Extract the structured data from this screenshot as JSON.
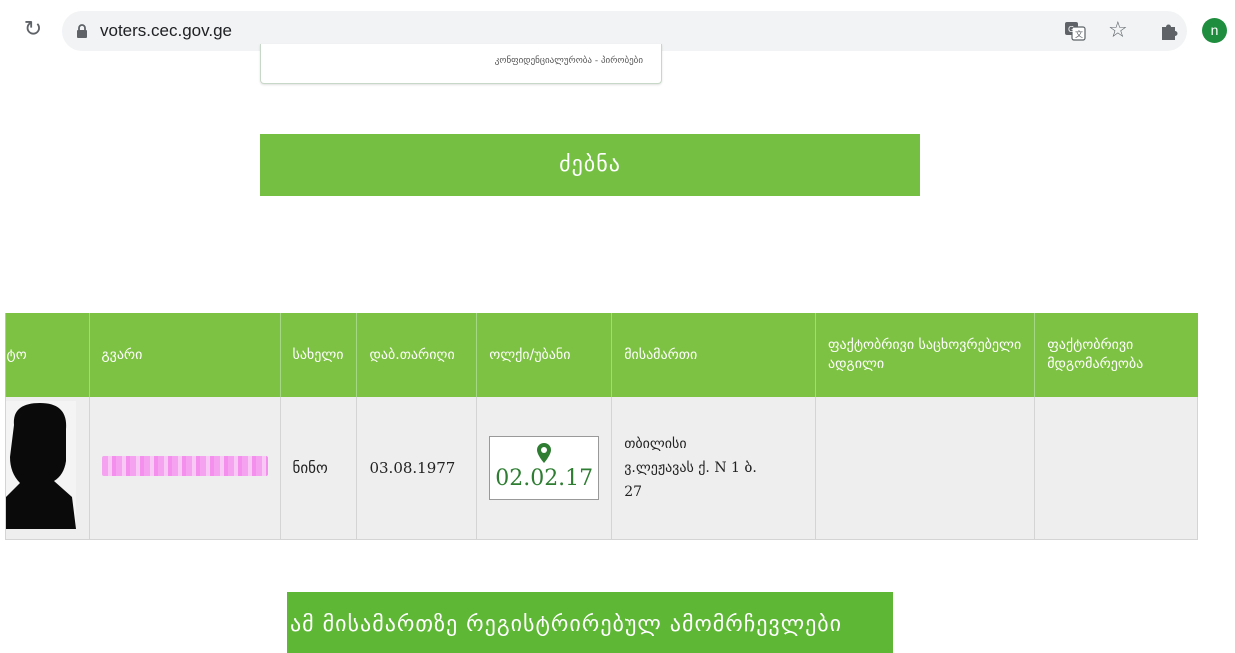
{
  "browser": {
    "url": "voters.cec.gov.ge",
    "avatar_initial": "n"
  },
  "captcha": {
    "links": "კონფიდენციალურობა - პირობები"
  },
  "search_button": "ძებნა",
  "table": {
    "headers": {
      "photo": "ფოტო",
      "surname": "გვარი",
      "name": "სახელი",
      "dob": "დაბ.თარიღი",
      "district": "ოლქი/უბანი",
      "address": "მისამართი",
      "actual_residence": "ფაქტობრივი საცხოვრებელი ადგილი",
      "actual_status": "ფაქტობრივი მდგომარეობა"
    },
    "row": {
      "name": "ნინო",
      "dob": "03.08.1977",
      "district_code": "02.02.17",
      "address_city": "თბილისი",
      "address_street": "ვ.ლეჟავას ქ.",
      "address_num1": "N 1 ბ.",
      "address_num2": "27",
      "actual_residence": "",
      "actual_status": ""
    }
  },
  "voters_button": "ამ მისამართზე რეგისტრირებულ ამომრჩევლები",
  "colors": {
    "header_green": "#7dc242",
    "button_green": "#75c043",
    "district_code": "#2e7d32"
  }
}
